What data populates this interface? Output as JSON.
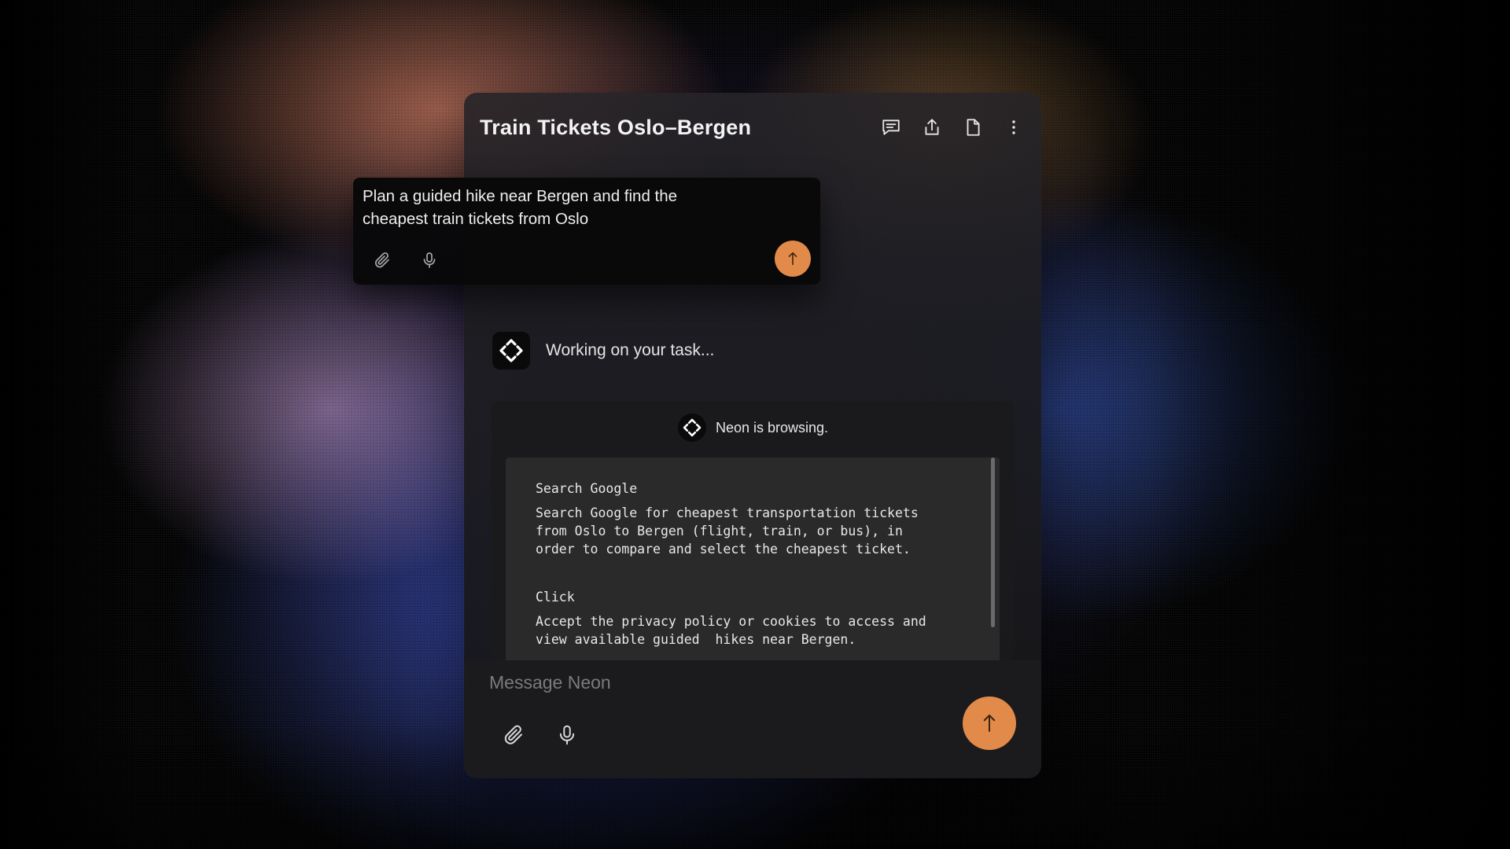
{
  "colors": {
    "accent": "#e28a49",
    "panel": "#1c1c1e",
    "text": "#f3f3f3",
    "placeholder": "#7b7b7e"
  },
  "header": {
    "title": "Train Tickets Oslo–Bergen",
    "actions": [
      "chat-bubble-icon",
      "share-icon",
      "document-icon",
      "more-vertical-icon"
    ]
  },
  "prompt": {
    "text": "Plan a guided hike near Bergen and find the cheapest train tickets from Oslo",
    "tools": [
      "paperclip-icon",
      "microphone-icon"
    ],
    "send_icon": "arrow-up-icon"
  },
  "status": {
    "text": "Working on your task...",
    "icon": "neon-logo-icon"
  },
  "browsing": {
    "title": "Neon is browsing.",
    "steps": [
      {
        "title": "Search Google",
        "description": "Search Google for cheapest transportation tickets\nfrom Oslo to Bergen (flight, train, or bus), in\norder to compare and select the cheapest ticket."
      },
      {
        "title": "Click",
        "description": "Accept the privacy policy or cookies to access and\nview available guided  hikes near Bergen."
      }
    ]
  },
  "composer": {
    "placeholder": "Message Neon",
    "value": "",
    "tools": [
      "paperclip-icon",
      "microphone-icon"
    ],
    "send_icon": "arrow-up-icon"
  }
}
